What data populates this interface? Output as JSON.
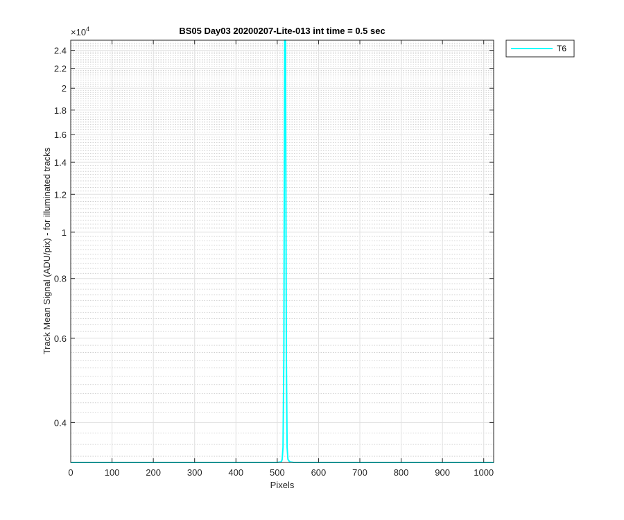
{
  "chart_data": {
    "type": "line",
    "title": "BS05 Day03 20200207-Lite-013 int time = 0.5 sec",
    "xlabel": "Pixels",
    "ylabel": "Track Mean Signal (ADU/pix) - for illuminated tracks",
    "y_exponent_label": "×10",
    "y_exponent_power": "4",
    "xlim": [
      0,
      1024
    ],
    "ylim": [
      3300,
      25200
    ],
    "yscale": "log",
    "grid": true,
    "minor_grid": true,
    "legend_position": "outside-top-right",
    "x_ticks": [
      0,
      100,
      200,
      300,
      400,
      500,
      600,
      700,
      800,
      900,
      1000
    ],
    "x_tick_labels": [
      "0",
      "100",
      "200",
      "300",
      "400",
      "500",
      "600",
      "700",
      "800",
      "900",
      "1000"
    ],
    "y_ticks": [
      4000,
      6000,
      8000,
      10000,
      12000,
      14000,
      16000,
      18000,
      20000,
      22000,
      24000
    ],
    "y_tick_labels": [
      "0.4",
      "0.6",
      "0.8",
      "1",
      "1.2",
      "1.4",
      "1.6",
      "1.8",
      "2",
      "2.2",
      "2.4"
    ],
    "series": [
      {
        "name": "T6",
        "color": "#00ffff",
        "x": [
          0,
          100,
          200,
          300,
          400,
          500,
          510,
          512,
          514,
          516,
          517,
          518,
          519,
          520,
          521,
          522,
          524,
          526,
          530,
          540,
          600,
          700,
          800,
          900,
          1024
        ],
        "y": [
          3300,
          3300,
          3300,
          3300,
          3300,
          3300,
          3310,
          3350,
          3550,
          5500,
          12000,
          25200,
          25200,
          25200,
          12000,
          5500,
          3550,
          3350,
          3310,
          3300,
          3300,
          3300,
          3300,
          3300,
          3300
        ]
      }
    ]
  }
}
